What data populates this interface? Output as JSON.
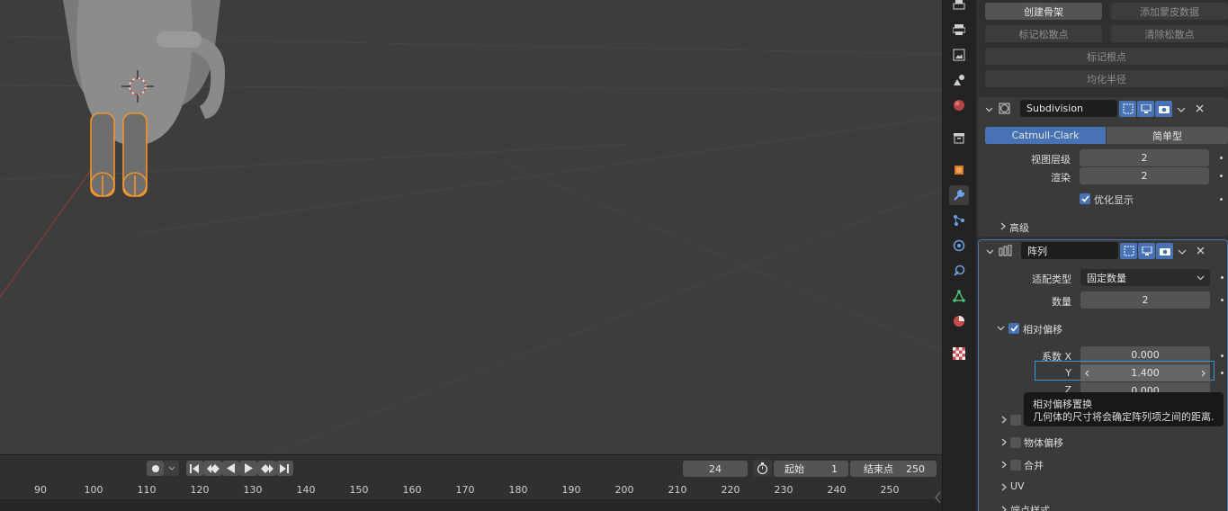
{
  "timeline": {
    "current_frame": "24",
    "start_label": "起始",
    "start_value": "1",
    "end_label": "结束点",
    "end_value": "250",
    "ruler_ticks": [
      "90",
      "100",
      "110",
      "120",
      "130",
      "140",
      "150",
      "160",
      "170",
      "180",
      "190",
      "200",
      "210",
      "220",
      "230",
      "240",
      "250"
    ]
  },
  "hair_buttons": {
    "create_skeleton": "创建骨架",
    "add_grease": "添加蒙皮数据",
    "mark_loose": "标记松散点",
    "clear_loose": "清除松散点",
    "mark_root": "标记根点",
    "equalize_radius": "均化半径"
  },
  "subdivision": {
    "name": "Subdivision",
    "mode_active": "Catmull-Clark",
    "mode_other": "简单型",
    "viewport_levels_label": "视图层级",
    "viewport_levels_value": "2",
    "render_label": "渲染",
    "render_value": "2",
    "optimize_label": "优化显示",
    "advanced_label": "高级"
  },
  "array": {
    "name": "阵列",
    "fit_type_label": "适配类型",
    "fit_type_value": "固定数量",
    "count_label": "数量",
    "count_value": "2",
    "relative_offset_label": "相对偏移",
    "factor_x_label": "系数 X",
    "factor_x_value": "0.000",
    "factor_y_label": "Y",
    "factor_y_value": "1.400",
    "factor_z_label": "Z",
    "factor_z_value": "0.000",
    "object_offset_label": "物体偏移",
    "merge_label": "合并",
    "uv_label": "UV",
    "caps_label": "端点样式"
  },
  "tooltip": {
    "title": "相对偏移置换",
    "description": "几何体的尺寸将会确定阵列项之间的距离."
  },
  "colors": {
    "accent": "#4772b3",
    "selection": "#f0962e",
    "highlight_box": "#2f9bd9"
  }
}
